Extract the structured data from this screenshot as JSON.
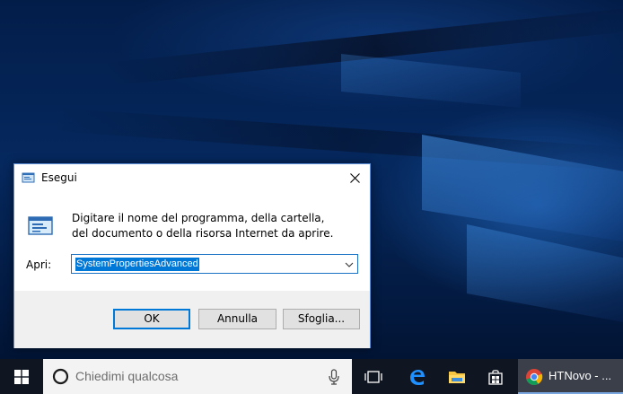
{
  "dialog": {
    "title": "Esegui",
    "description": "Digitare il nome del programma, della cartella, del documento o della risorsa Internet da aprire.",
    "open_label": "Apri:",
    "open_value": "SystemPropertiesAdvanced",
    "ok_label": "OK",
    "cancel_label": "Annulla",
    "browse_label": "Sfoglia...",
    "accent_color": "#0078d7"
  },
  "taskbar": {
    "search_placeholder": "Chiedimi qualcosa",
    "pinned": [
      "task-view-icon",
      "edge-icon",
      "file-explorer-icon",
      "store-icon"
    ],
    "chrome_window_label": "HTNovo - ..."
  }
}
